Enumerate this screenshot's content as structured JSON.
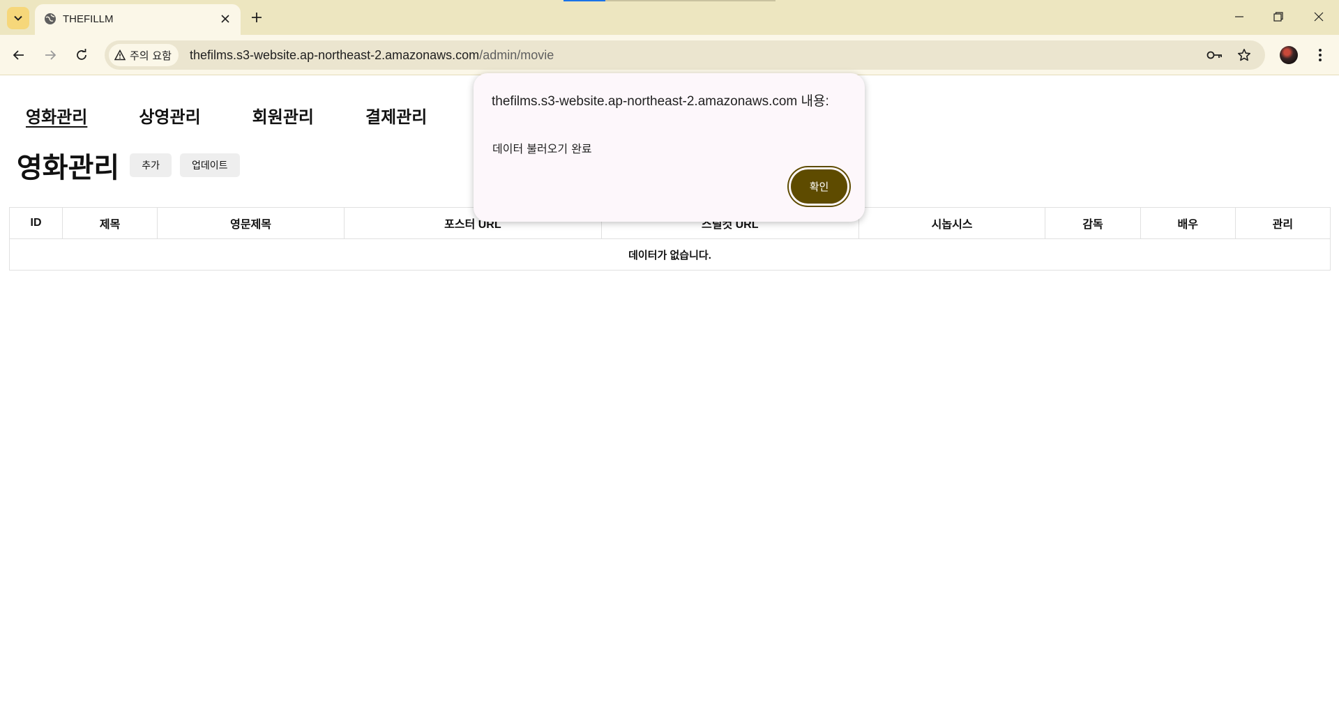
{
  "browser": {
    "tab_title": "THEFILLM",
    "security_chip": "주의 요함",
    "url_host": "thefilms.s3-website.ap-northeast-2.amazonaws.com",
    "url_path": "/admin/movie"
  },
  "nav": {
    "items": [
      "영화관리",
      "상영관리",
      "회원관리",
      "결제관리"
    ]
  },
  "main": {
    "heading": "영화관리",
    "add_label": "추가",
    "update_label": "업데이트"
  },
  "table": {
    "columns": [
      "ID",
      "제목",
      "영문제목",
      "포스터 URL",
      "스틸컷 URL",
      "시놉시스",
      "감독",
      "배우",
      "관리"
    ],
    "empty_message": "데이터가 없습니다."
  },
  "dialog": {
    "title": "thefilms.s3-website.ap-northeast-2.amazonaws.com 내용:",
    "message": "데이터 불러오기 완료",
    "ok_label": "확인"
  },
  "colors": {
    "chrome_bg": "#ede6c0",
    "toolbar_bg": "#fbf7e8",
    "dialog_button": "#5e4b00"
  }
}
